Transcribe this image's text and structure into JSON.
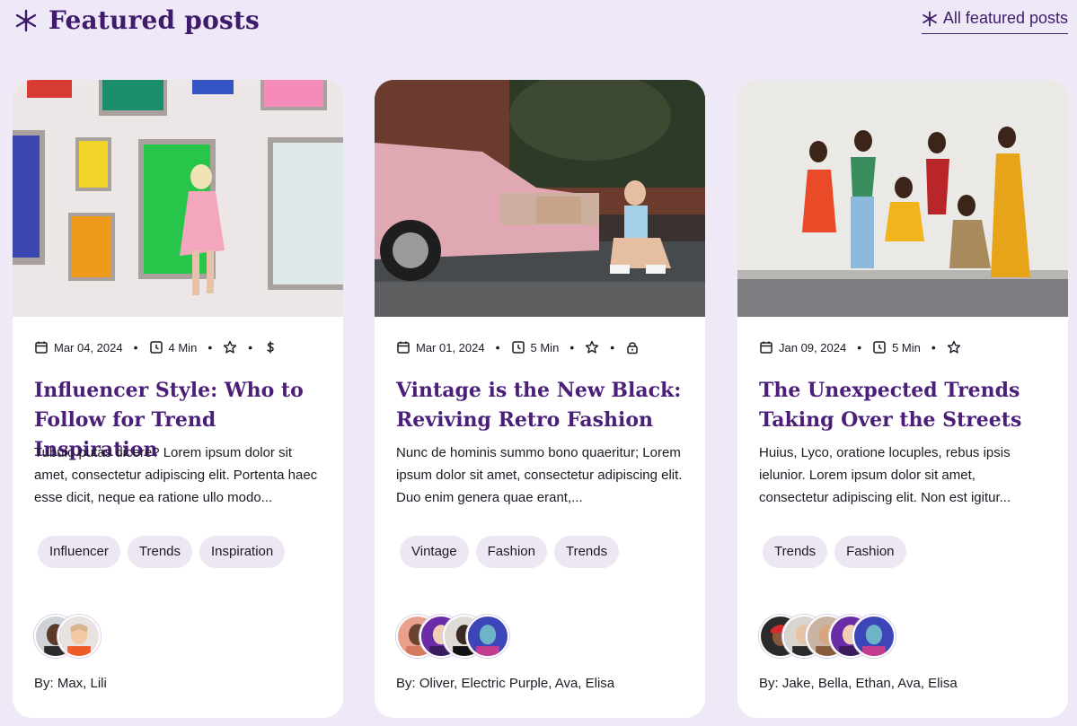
{
  "header": {
    "title": "Featured posts",
    "all_link": "All featured posts",
    "accent": "#3f1b6b"
  },
  "cards": [
    {
      "date": "Mar 04, 2024",
      "read_time": "4 Min",
      "extra_icons": [
        "star-icon",
        "dollar-icon"
      ],
      "title": "Influencer Style: Who to Follow for Trend Inspiration",
      "excerpt": "Tubulo putas dicere? Lorem ipsum dolor sit amet, consectetur adipiscing elit. Portenta haec esse dicit, neque ea ratione ullo modo...",
      "tags": [
        "Influencer",
        "Trends",
        "Inspiration"
      ],
      "authors": [
        "Max",
        "Lili"
      ],
      "byline": "By: Max, Lili"
    },
    {
      "date": "Mar 01, 2024",
      "read_time": "5 Min",
      "extra_icons": [
        "star-icon",
        "lock-icon"
      ],
      "title": "Vintage is the New Black: Reviving Retro Fashion",
      "excerpt": "Nunc de hominis summo bono quaeritur; Lorem ipsum dolor sit amet, consectetur adipiscing elit. Duo enim genera quae erant,...",
      "tags": [
        "Vintage",
        "Fashion",
        "Trends"
      ],
      "authors": [
        "Oliver",
        "Electric Purple",
        "Ava",
        "Elisa"
      ],
      "byline": "By: Oliver, Electric Purple, Ava, Elisa"
    },
    {
      "date": "Jan 09, 2024",
      "read_time": "5 Min",
      "extra_icons": [
        "star-icon"
      ],
      "title": "The Unexpected Trends Taking Over the Streets",
      "excerpt": "Huius, Lyco, oratione locuples, rebus ipsis ielunior. Lorem ipsum dolor sit amet, consectetur adipiscing elit. Non est igitur...",
      "tags": [
        "Trends",
        "Fashion"
      ],
      "authors": [
        "Jake",
        "Bella",
        "Ethan",
        "Ava",
        "Elisa"
      ],
      "byline": "By: Jake, Bella, Ethan, Ava, Elisa"
    }
  ]
}
